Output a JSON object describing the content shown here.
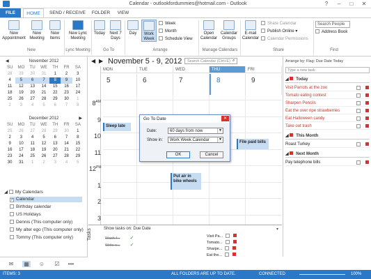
{
  "window": {
    "title": "Calendar - outlookfordummies@hotmail.com - Outlook"
  },
  "tabs": [
    "FILE",
    "HOME",
    "SEND / RECEIVE",
    "FOLDER",
    "VIEW"
  ],
  "ribbon": {
    "new_appointment": "New\nAppointment",
    "new_meeting": "New\nMeeting",
    "new_items": "New\nItems",
    "new_lync_meeting": "New Lync\nMeeting",
    "today": "Today",
    "next7": "Next 7\nDays",
    "day": "Day",
    "work_week": "Work\nWeek",
    "week": "Week",
    "month": "Month",
    "schedule_view": "Schedule View",
    "open_calendar": "Open\nCalendar",
    "calendar_groups": "Calendar\nGroups",
    "email_calendar": "E-mail\nCalendar",
    "share_calendar": "Share Calendar",
    "publish_online": "Publish Online",
    "calendar_permissions": "Calendar Permissions",
    "search_people": "Search People",
    "address_book": "Address Book",
    "groups": [
      "New",
      "Lync Meeting",
      "Go To",
      "Arrange",
      "Manage Calendars",
      "Share",
      "Find"
    ]
  },
  "mini_calendars": [
    {
      "title": "November 2012",
      "dow": [
        "SU",
        "MO",
        "TU",
        "WE",
        "TH",
        "FR",
        "SA"
      ],
      "weeks": [
        [
          "28",
          "29",
          "30",
          "31",
          "1",
          "2",
          "3"
        ],
        [
          "4",
          "5",
          "6",
          "7",
          "8",
          "9",
          "10"
        ],
        [
          "11",
          "12",
          "13",
          "14",
          "15",
          "16",
          "17"
        ],
        [
          "18",
          "19",
          "20",
          "21",
          "22",
          "23",
          "24"
        ],
        [
          "25",
          "26",
          "27",
          "28",
          "29",
          "30",
          "1"
        ],
        [
          "2",
          "3",
          "4",
          "5",
          "6",
          "7",
          "8"
        ]
      ]
    },
    {
      "title": "December 2012",
      "dow": [
        "SU",
        "MO",
        "TU",
        "WE",
        "TH",
        "FR",
        "SA"
      ],
      "weeks": [
        [
          "25",
          "26",
          "27",
          "28",
          "29",
          "30",
          "1"
        ],
        [
          "2",
          "3",
          "4",
          "5",
          "6",
          "7",
          "8"
        ],
        [
          "9",
          "10",
          "11",
          "12",
          "13",
          "14",
          "15"
        ],
        [
          "16",
          "17",
          "18",
          "19",
          "20",
          "21",
          "22"
        ],
        [
          "23",
          "24",
          "25",
          "26",
          "27",
          "28",
          "29"
        ],
        [
          "30",
          "31",
          "1",
          "2",
          "3",
          "4",
          "5"
        ]
      ]
    }
  ],
  "my_calendars": {
    "header": "My Calendars",
    "items": [
      {
        "label": "Calendar",
        "checked": true
      },
      {
        "label": "Birthday calendar",
        "checked": false
      },
      {
        "label": "US Holidays",
        "checked": false
      },
      {
        "label": "Dennis (This computer only)",
        "checked": false
      },
      {
        "label": "My alter ego (This computer only)",
        "checked": false
      },
      {
        "label": "Tommy (This computer only)",
        "checked": false
      }
    ]
  },
  "calendar": {
    "range_title": "November 5 - 9, 2012",
    "search_placeholder": "Search Calendar (Ctrl+E)",
    "days": [
      {
        "dow": "MON",
        "num": "5"
      },
      {
        "dow": "TUE",
        "num": "6"
      },
      {
        "dow": "WED",
        "num": "7"
      },
      {
        "dow": "THU",
        "num": "8"
      },
      {
        "dow": "FRI",
        "num": "9"
      }
    ],
    "hours": [
      "8",
      "9",
      "10",
      "11",
      "12",
      "1",
      "2",
      "3"
    ],
    "hour_suffix_8": "AM",
    "hour_suffix_12": "PM",
    "appointments": {
      "sleep": "Sleep late",
      "bills": "File paid bills",
      "air": "Put air in bike wheels"
    }
  },
  "dialog": {
    "title": "Go To Date",
    "date_label": "Date:",
    "date_value": "60 days from now",
    "show_in_label": "Show in:",
    "show_in_value": "Work Week Calendar",
    "ok": "OK",
    "cancel": "Cancel"
  },
  "tasks_pane": {
    "vertical_label": "Tasks",
    "header": "Show tasks on: Due Date",
    "mon_items": [
      "Wash f...",
      "Write s..."
    ],
    "fri_items": [
      "Visit Pa...",
      "Tomato...",
      "Sharpe...",
      "Eat the..."
    ]
  },
  "todo": {
    "arrange": "Arrange by: Flag: Due Date",
    "arrange_right": "Today",
    "new_task_placeholder": "Type a new task",
    "groups": [
      {
        "label": "Today",
        "items": [
          "Visit Parrots at the zoo",
          "Tomato eating contest",
          "Sharpen Pencils",
          "Eat the over ripe strawberries",
          "Eat Halloween candy",
          "Take out trash"
        ]
      },
      {
        "label": "This Month",
        "items": [
          "Roast Turkey"
        ]
      },
      {
        "label": "Next Month",
        "items": [
          "Pay telephone bills"
        ]
      }
    ]
  },
  "status": {
    "items": "ITEMS: 3",
    "sync": "ALL FOLDERS ARE UP TO DATE.",
    "connected": "CONNECTED",
    "zoom": "100%"
  }
}
